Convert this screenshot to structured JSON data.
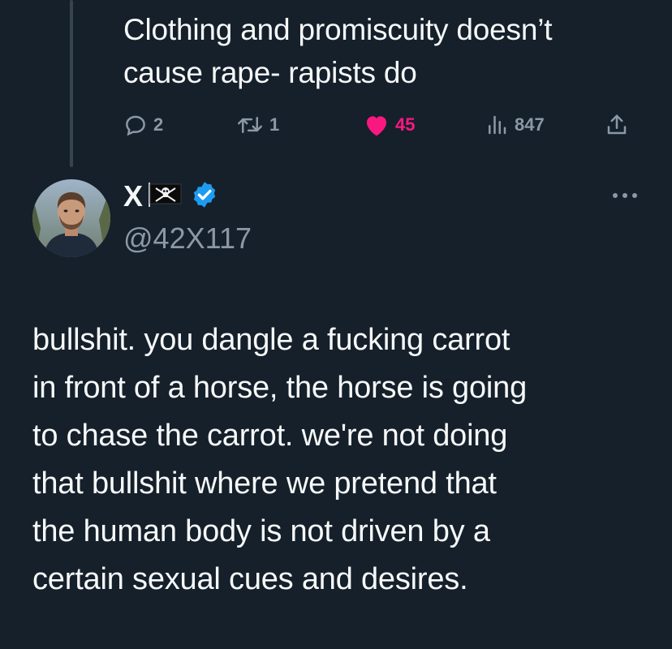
{
  "parent_tweet": {
    "text_lines": [
      "Clothing and promiscuity doesn’t",
      "cause rape- rapists do"
    ],
    "actions": {
      "replies": "2",
      "retweets": "1",
      "likes": "45",
      "views": "847"
    }
  },
  "reply_tweet": {
    "display_name": "X",
    "handle": "@42X117",
    "verified": true,
    "icons": {
      "flag": "pirate-flag-icon",
      "verified": "verified-badge-icon",
      "more": "more-options-icon"
    },
    "body_lines": [
      "bullshit. you dangle a fucking carrot",
      "in front of a horse, the horse is going",
      "to chase the carrot. we're not doing",
      "that bullshit where we pretend that",
      "the human body is not driven by a",
      "certain sexual cues and desires."
    ]
  },
  "colors": {
    "background": "#15202b",
    "text": "#f7f9f9",
    "muted": "#8b98a5",
    "like": "#f91880",
    "verified": "#1d9bf0",
    "thread_line": "#38444d"
  }
}
